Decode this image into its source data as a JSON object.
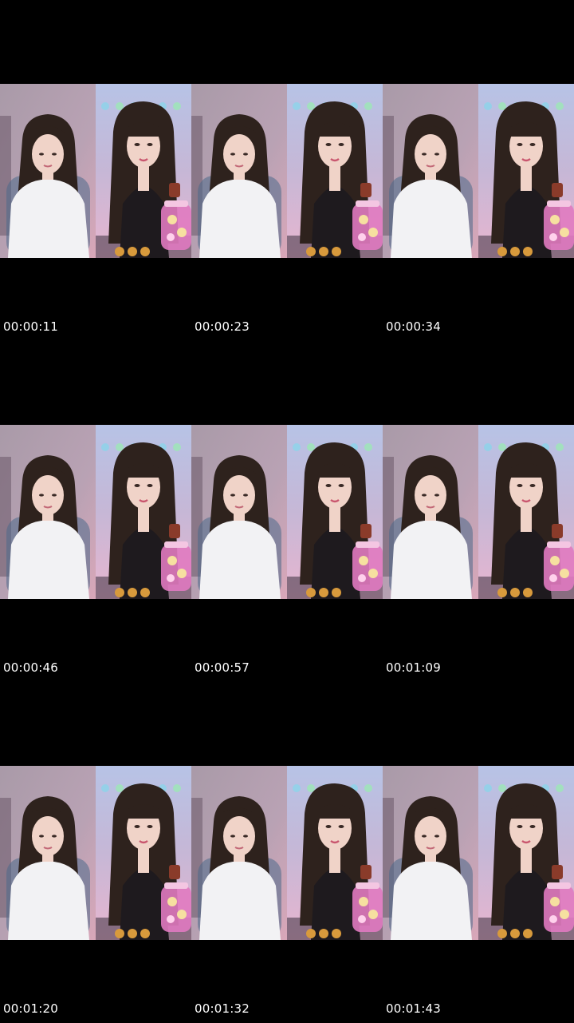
{
  "contact_sheet": {
    "background": "#000000",
    "thumbnails": [
      {
        "timestamp": "00:00:11"
      },
      {
        "timestamp": "00:00:23"
      },
      {
        "timestamp": "00:00:34"
      },
      {
        "timestamp": "00:00:46"
      },
      {
        "timestamp": "00:00:57"
      },
      {
        "timestamp": "00:01:09"
      },
      {
        "timestamp": "00:01:20"
      },
      {
        "timestamp": "00:01:32"
      },
      {
        "timestamp": "00:01:43"
      }
    ]
  },
  "colors": {
    "left_wall": "#b9a2b4",
    "right_wall": "#c6b7d6",
    "hair": "#2e221d",
    "skin": "#f0d3c8",
    "shirt": "#f2f2f4",
    "dress": "#1e1a1e",
    "jar": "#e07ac0",
    "timestamp_text": "#ffffff"
  }
}
